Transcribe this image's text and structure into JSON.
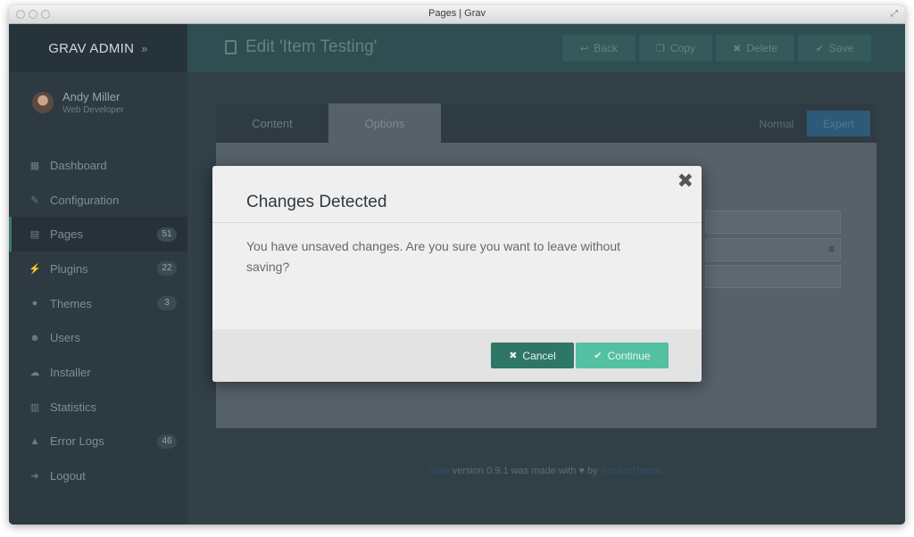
{
  "window": {
    "title": "Pages | Grav"
  },
  "sidebar": {
    "brand": "GRAV ADMIN",
    "brand_chevron": "»",
    "user": {
      "name": "Andy Miller",
      "role": "Web Developer"
    },
    "items": [
      {
        "label": "Dashboard",
        "icon": "grid-icon",
        "glyph": "▦",
        "badge": ""
      },
      {
        "label": "Configuration",
        "icon": "wrench-icon",
        "glyph": "✎",
        "badge": ""
      },
      {
        "label": "Pages",
        "icon": "file-icon",
        "glyph": "▤",
        "badge": "51"
      },
      {
        "label": "Plugins",
        "icon": "plug-icon",
        "glyph": "⚡",
        "badge": "22"
      },
      {
        "label": "Themes",
        "icon": "drop-icon",
        "glyph": "●",
        "badge": "3"
      },
      {
        "label": "Users",
        "icon": "user-icon",
        "glyph": "☻",
        "badge": ""
      },
      {
        "label": "Installer",
        "icon": "cloud-download-icon",
        "glyph": "☁",
        "badge": ""
      },
      {
        "label": "Statistics",
        "icon": "bar-chart-icon",
        "glyph": "▥",
        "badge": ""
      },
      {
        "label": "Error Logs",
        "icon": "warning-icon",
        "glyph": "▲",
        "badge": "46"
      },
      {
        "label": "Logout",
        "icon": "sign-out-icon",
        "glyph": "➜",
        "badge": ""
      }
    ]
  },
  "header": {
    "title": "Edit 'Item Testing'",
    "buttons": {
      "back": "Back",
      "copy": "Copy",
      "delete": "Delete",
      "save": "Save"
    }
  },
  "editor": {
    "tabs": [
      "Content",
      "Options"
    ],
    "active_tab": "Options",
    "modes": [
      "Normal",
      "Expert"
    ],
    "active_mode": "Expert"
  },
  "footer": {
    "link1": "Grav",
    "text1": " version 0.9.1 was made with ",
    "heart": "♥",
    "text2": " by ",
    "link2": "RocketTheme",
    "text3": "."
  },
  "modal": {
    "title": "Changes Detected",
    "body": "You have unsaved changes. Are you sure you want to leave without saving?",
    "cancel": "Cancel",
    "continue": "Continue"
  },
  "colors": {
    "accent": "#53c0a1",
    "cancel": "#2e7666",
    "topbar": "#2f4e51",
    "sidebar": "#2d3a41"
  }
}
